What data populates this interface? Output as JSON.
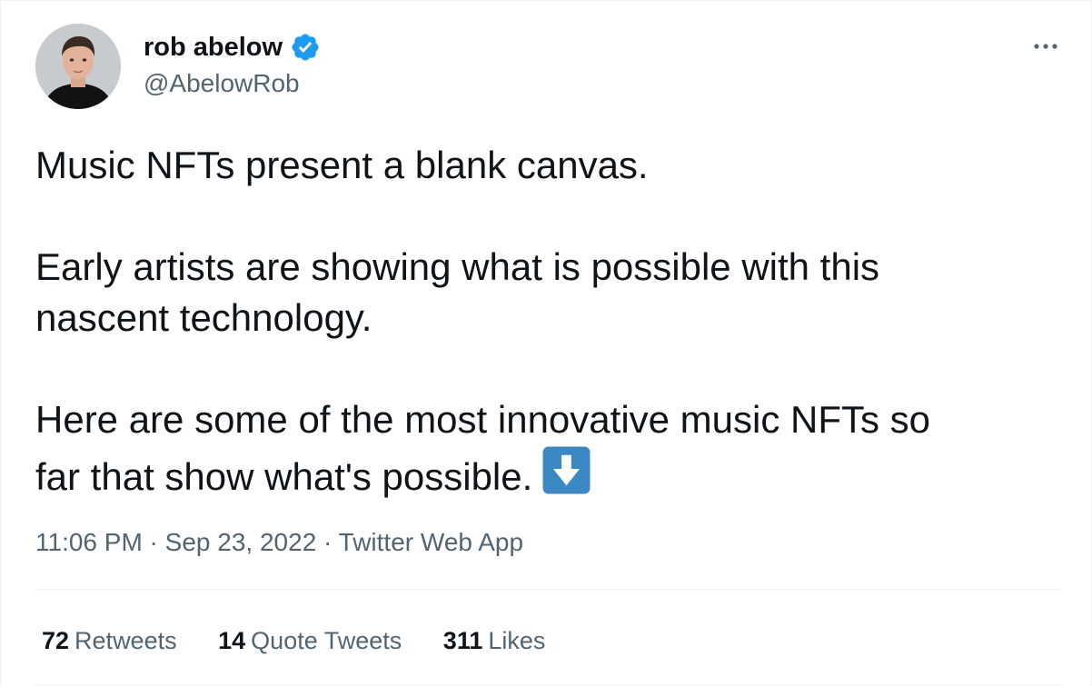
{
  "author": {
    "name": "rob abelow",
    "handle": "@AbelowRob",
    "verified": true,
    "avatar_icon": "person-portrait-avatar"
  },
  "tweet": {
    "paragraphs": [
      "Music NFTs present a blank canvas.",
      "Early artists are showing what is possible with this\nnascent technology.",
      "Here are some of the most innovative music NFTs so\nfar that show what's possible."
    ],
    "emoji": "down-arrow-emoji"
  },
  "meta": {
    "time": "11:06 PM",
    "separator": " · ",
    "date": "Sep 23, 2022",
    "source": "Twitter Web App"
  },
  "stats": {
    "retweets_count": "72",
    "retweets_label": "Retweets",
    "quotes_count": "14",
    "quotes_label": "Quote Tweets",
    "likes_count": "311",
    "likes_label": "Likes"
  },
  "colors": {
    "text": "#0f1419",
    "secondary": "#536471",
    "verified_blue": "#1d9bf0",
    "divider": "#eff3f4",
    "emoji_blue": "#3b88c3"
  }
}
